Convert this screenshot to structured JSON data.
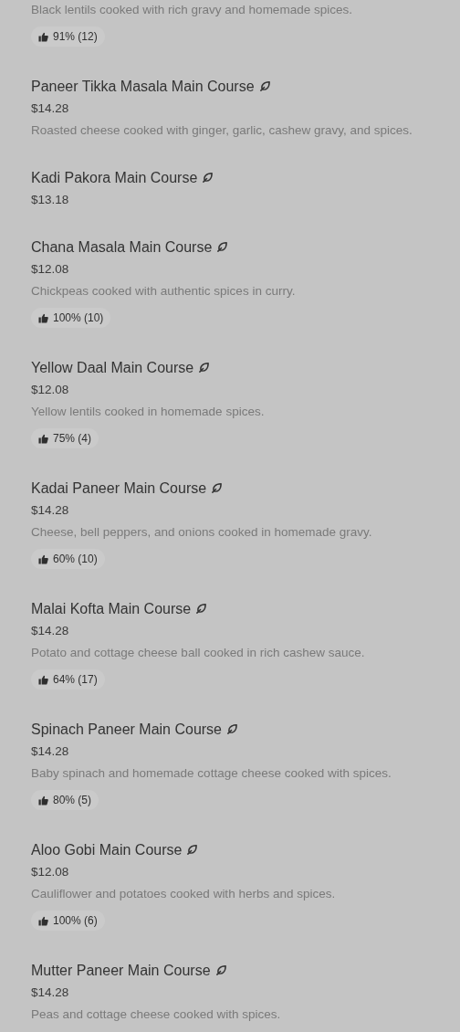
{
  "items": [
    {
      "description": "Black lentils cooked with rich gravy and homemade spices.",
      "rating": "91% (12)"
    },
    {
      "name": "Paneer Tikka Masala Main Course",
      "price": "$14.28",
      "description": "Roasted cheese cooked with ginger, garlic, cashew gravy, and spices."
    },
    {
      "name": "Kadi Pakora Main Course",
      "price": "$13.18"
    },
    {
      "name": "Chana Masala Main Course",
      "price": "$12.08",
      "description": "Chickpeas cooked with authentic spices in curry.",
      "rating": "100% (10)"
    },
    {
      "name": "Yellow Daal Main Course",
      "price": "$12.08",
      "description": "Yellow lentils cooked in homemade spices.",
      "rating": "75% (4)"
    },
    {
      "name": "Kadai Paneer Main Course",
      "price": "$14.28",
      "description": "Cheese, bell peppers, and onions cooked in homemade gravy.",
      "rating": "60% (10)"
    },
    {
      "name": "Malai Kofta Main Course",
      "price": "$14.28",
      "description": "Potato and cottage cheese ball cooked in rich cashew sauce.",
      "rating": "64% (17)"
    },
    {
      "name": "Spinach Paneer Main Course",
      "price": "$14.28",
      "description": "Baby spinach and homemade cottage cheese cooked with spices.",
      "rating": "80% (5)"
    },
    {
      "name": "Aloo Gobi Main Course",
      "price": "$12.08",
      "description": "Cauliflower and potatoes cooked with herbs and spices.",
      "rating": "100% (6)"
    },
    {
      "name": "Mutter Paneer Main Course",
      "price": "$14.28",
      "description": "Peas and cottage cheese cooked with spices."
    }
  ]
}
